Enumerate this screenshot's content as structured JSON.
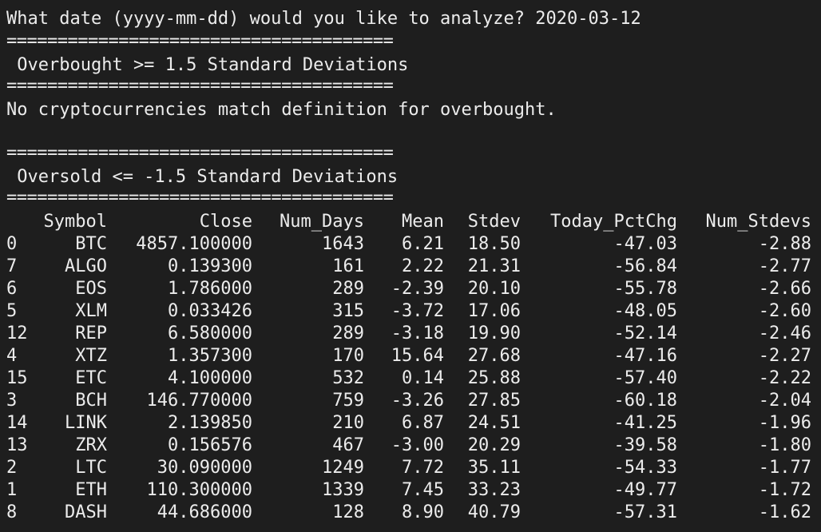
{
  "prompt": "What date (yyyy-mm-dd) would you like to analyze? 2020-03-12",
  "separator": "======================================",
  "overbought": {
    "title": " Overbought >= 1.5 Standard Deviations",
    "message": "No cryptocurrencies match definition for overbought."
  },
  "oversold": {
    "title": " Oversold <= -1.5 Standard Deviations",
    "headers": [
      "Symbol",
      "Close",
      "Num_Days",
      "Mean",
      "Stdev",
      "Today_PctChg",
      "Num_Stdevs"
    ],
    "rows": [
      {
        "idx": "0",
        "symbol": "BTC",
        "close": "4857.100000",
        "days": "1643",
        "mean": "6.21",
        "stdev": "18.50",
        "pct": "-47.03",
        "nstd": "-2.88"
      },
      {
        "idx": "7",
        "symbol": "ALGO",
        "close": "0.139300",
        "days": "161",
        "mean": "2.22",
        "stdev": "21.31",
        "pct": "-56.84",
        "nstd": "-2.77"
      },
      {
        "idx": "6",
        "symbol": "EOS",
        "close": "1.786000",
        "days": "289",
        "mean": "-2.39",
        "stdev": "20.10",
        "pct": "-55.78",
        "nstd": "-2.66"
      },
      {
        "idx": "5",
        "symbol": "XLM",
        "close": "0.033426",
        "days": "315",
        "mean": "-3.72",
        "stdev": "17.06",
        "pct": "-48.05",
        "nstd": "-2.60"
      },
      {
        "idx": "12",
        "symbol": "REP",
        "close": "6.580000",
        "days": "289",
        "mean": "-3.18",
        "stdev": "19.90",
        "pct": "-52.14",
        "nstd": "-2.46"
      },
      {
        "idx": "4",
        "symbol": "XTZ",
        "close": "1.357300",
        "days": "170",
        "mean": "15.64",
        "stdev": "27.68",
        "pct": "-47.16",
        "nstd": "-2.27"
      },
      {
        "idx": "15",
        "symbol": "ETC",
        "close": "4.100000",
        "days": "532",
        "mean": "0.14",
        "stdev": "25.88",
        "pct": "-57.40",
        "nstd": "-2.22"
      },
      {
        "idx": "3",
        "symbol": "BCH",
        "close": "146.770000",
        "days": "759",
        "mean": "-3.26",
        "stdev": "27.85",
        "pct": "-60.18",
        "nstd": "-2.04"
      },
      {
        "idx": "14",
        "symbol": "LINK",
        "close": "2.139850",
        "days": "210",
        "mean": "6.87",
        "stdev": "24.51",
        "pct": "-41.25",
        "nstd": "-1.96"
      },
      {
        "idx": "13",
        "symbol": "ZRX",
        "close": "0.156576",
        "days": "467",
        "mean": "-3.00",
        "stdev": "20.29",
        "pct": "-39.58",
        "nstd": "-1.80"
      },
      {
        "idx": "2",
        "symbol": "LTC",
        "close": "30.090000",
        "days": "1249",
        "mean": "7.72",
        "stdev": "35.11",
        "pct": "-54.33",
        "nstd": "-1.77"
      },
      {
        "idx": "1",
        "symbol": "ETH",
        "close": "110.300000",
        "days": "1339",
        "mean": "7.45",
        "stdev": "33.23",
        "pct": "-49.77",
        "nstd": "-1.72"
      },
      {
        "idx": "8",
        "symbol": "DASH",
        "close": "44.686000",
        "days": "128",
        "mean": "8.90",
        "stdev": "40.79",
        "pct": "-57.31",
        "nstd": "-1.62"
      }
    ]
  },
  "colors": {
    "background": "#1e1e1e",
    "text": "#ececec"
  }
}
